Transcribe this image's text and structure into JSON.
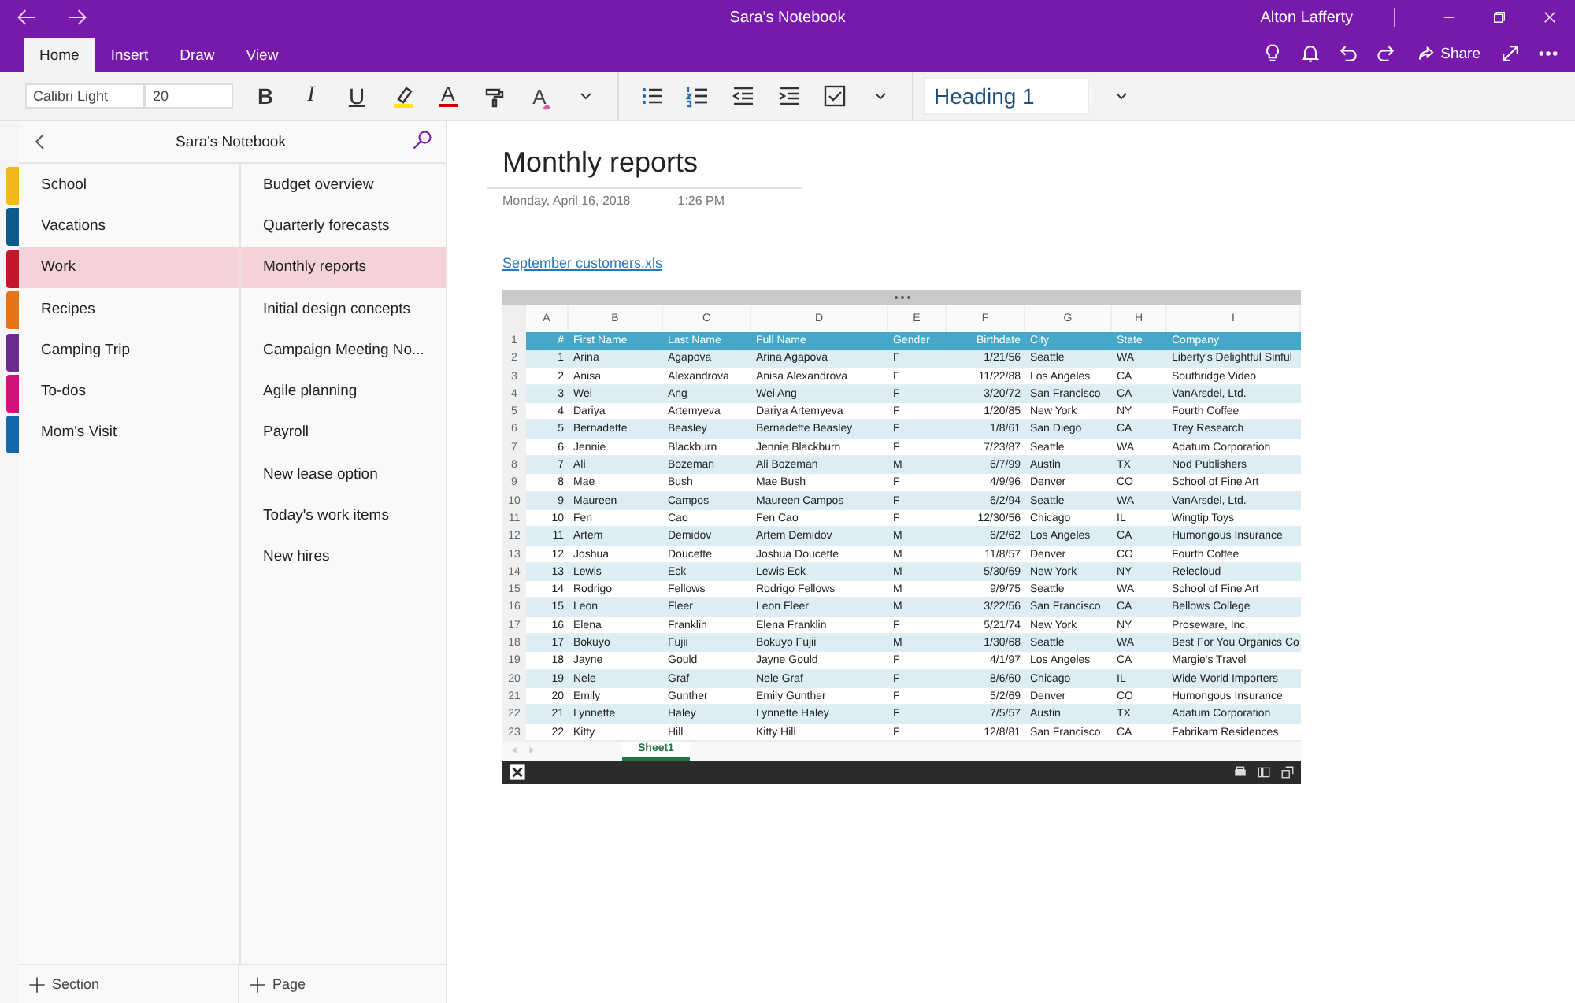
{
  "window": {
    "title": "Sara's Notebook",
    "user": "Alton Lafferty"
  },
  "ribbon_tabs": [
    {
      "label": "Home",
      "selected": true
    },
    {
      "label": "Insert",
      "selected": false
    },
    {
      "label": "Draw",
      "selected": false
    },
    {
      "label": "View",
      "selected": false
    }
  ],
  "share_button": "Share",
  "toolbar": {
    "font_name": "Calibri Light",
    "font_size": "20",
    "bold": "B",
    "italic": "I",
    "underline": "U",
    "font_color": "A",
    "clear_formatting": "A",
    "style": "Heading 1"
  },
  "notebook": {
    "title": "Sara's Notebook"
  },
  "sections": [
    {
      "label": "School",
      "color": "#f2b81c",
      "selected": false
    },
    {
      "label": "Vacations",
      "color": "#0e5a8a",
      "selected": false
    },
    {
      "label": "Work",
      "color": "#c6162b",
      "selected": true
    },
    {
      "label": "Recipes",
      "color": "#e8741a",
      "selected": false
    },
    {
      "label": "Camping Trip",
      "color": "#6a2c91",
      "selected": false
    },
    {
      "label": "To-dos",
      "color": "#d0157a",
      "selected": false
    },
    {
      "label": "Mom's Visit",
      "color": "#1467a8",
      "selected": false
    }
  ],
  "pages": [
    {
      "label": "Budget overview",
      "selected": false
    },
    {
      "label": "Quarterly forecasts",
      "selected": false
    },
    {
      "label": "Monthly reports",
      "selected": true
    },
    {
      "label": "Initial design concepts",
      "selected": false
    },
    {
      "label": "Campaign Meeting No...",
      "selected": false
    },
    {
      "label": "Agile planning",
      "selected": false
    },
    {
      "label": "Payroll",
      "selected": false
    },
    {
      "label": "New lease option",
      "selected": false
    },
    {
      "label": "Today's work items",
      "selected": false
    },
    {
      "label": "New hires",
      "selected": false
    }
  ],
  "add_section": "Section",
  "add_page": "Page",
  "page": {
    "title": "Monthly reports",
    "date": "Monday, April 16, 2018",
    "time": "1:26 PM",
    "attachment_link": "September customers.xls"
  },
  "spreadsheet": {
    "column_letters": [
      "A",
      "B",
      "C",
      "D",
      "E",
      "F",
      "G",
      "H",
      "I"
    ],
    "row_numbers": [
      "1",
      "2",
      "3",
      "4",
      "5",
      "6",
      "7",
      "8",
      "9",
      "10",
      "11",
      "12",
      "13",
      "14",
      "15",
      "16",
      "17",
      "18",
      "19",
      "20",
      "21",
      "22",
      "23"
    ],
    "header": [
      "#",
      "First Name",
      "Last Name",
      "Full Name",
      "Gender",
      "Birthdate",
      "City",
      "State",
      "Company"
    ],
    "rows": [
      [
        "1",
        "Arina",
        "Agapova",
        "Arina Agapova",
        "F",
        "1/21/56",
        "Seattle",
        "WA",
        "Liberty's Delightful Sinful"
      ],
      [
        "2",
        "Anisa",
        "Alexandrova",
        "Anisa Alexandrova",
        "F",
        "11/22/88",
        "Los Angeles",
        "CA",
        "Southridge Video"
      ],
      [
        "3",
        "Wei",
        "Ang",
        "Wei Ang",
        "F",
        "3/20/72",
        "San Francisco",
        "CA",
        "VanArsdel, Ltd."
      ],
      [
        "4",
        "Dariya",
        "Artemyeva",
        "Dariya Artemyeva",
        "F",
        "1/20/85",
        "New York",
        "NY",
        "Fourth Coffee"
      ],
      [
        "5",
        "Bernadette",
        "Beasley",
        "Bernadette Beasley",
        "F",
        "1/8/61",
        "San Diego",
        "CA",
        "Trey Research"
      ],
      [
        "6",
        "Jennie",
        "Blackburn",
        "Jennie Blackburn",
        "F",
        "7/23/87",
        "Seattle",
        "WA",
        "Adatum Corporation"
      ],
      [
        "7",
        "Ali",
        "Bozeman",
        "Ali Bozeman",
        "M",
        "6/7/99",
        "Austin",
        "TX",
        "Nod Publishers"
      ],
      [
        "8",
        "Mae",
        "Bush",
        "Mae Bush",
        "F",
        "4/9/96",
        "Denver",
        "CO",
        "School of Fine Art"
      ],
      [
        "9",
        "Maureen",
        "Campos",
        "Maureen Campos",
        "F",
        "6/2/94",
        "Seattle",
        "WA",
        "VanArsdel, Ltd."
      ],
      [
        "10",
        "Fen",
        "Cao",
        "Fen Cao",
        "F",
        "12/30/56",
        "Chicago",
        "IL",
        "Wingtip Toys"
      ],
      [
        "11",
        "Artem",
        "Demidov",
        "Artem Demidov",
        "M",
        "6/2/62",
        "Los Angeles",
        "CA",
        "Humongous Insurance"
      ],
      [
        "12",
        "Joshua",
        "Doucette",
        "Joshua Doucette",
        "M",
        "11/8/57",
        "Denver",
        "CO",
        "Fourth Coffee"
      ],
      [
        "13",
        "Lewis",
        "Eck",
        "Lewis Eck",
        "M",
        "5/30/69",
        "New York",
        "NY",
        "Relecloud"
      ],
      [
        "14",
        "Rodrigo",
        "Fellows",
        "Rodrigo Fellows",
        "M",
        "9/9/75",
        "Seattle",
        "WA",
        "School of Fine Art"
      ],
      [
        "15",
        "Leon",
        "Fleer",
        "Leon Fleer",
        "M",
        "3/22/56",
        "San Francisco",
        "CA",
        "Bellows College"
      ],
      [
        "16",
        "Elena",
        "Franklin",
        "Elena Franklin",
        "F",
        "5/21/74",
        "New York",
        "NY",
        "Proseware, Inc."
      ],
      [
        "17",
        "Bokuyo",
        "Fujii",
        "Bokuyo Fujii",
        "M",
        "1/30/68",
        "Seattle",
        "WA",
        "Best For You Organics Co"
      ],
      [
        "18",
        "Jayne",
        "Gould",
        "Jayne Gould",
        "F",
        "4/1/97",
        "Los Angeles",
        "CA",
        "Margie's Travel"
      ],
      [
        "19",
        "Nele",
        "Graf",
        "Nele Graf",
        "F",
        "8/6/60",
        "Chicago",
        "IL",
        "Wide World Importers"
      ],
      [
        "20",
        "Emily",
        "Gunther",
        "Emily Gunther",
        "F",
        "5/2/69",
        "Denver",
        "CO",
        "Humongous Insurance"
      ],
      [
        "21",
        "Lynnette",
        "Haley",
        "Lynnette Haley",
        "F",
        "7/5/57",
        "Austin",
        "TX",
        "Adatum Corporation"
      ],
      [
        "22",
        "Kitty",
        "Hill",
        "Kitty Hill",
        "F",
        "12/8/81",
        "San Francisco",
        "CA",
        "Fabrikam Residences"
      ]
    ],
    "sheet_tabs": [
      {
        "label": "Sheet1",
        "selected": true
      }
    ]
  }
}
